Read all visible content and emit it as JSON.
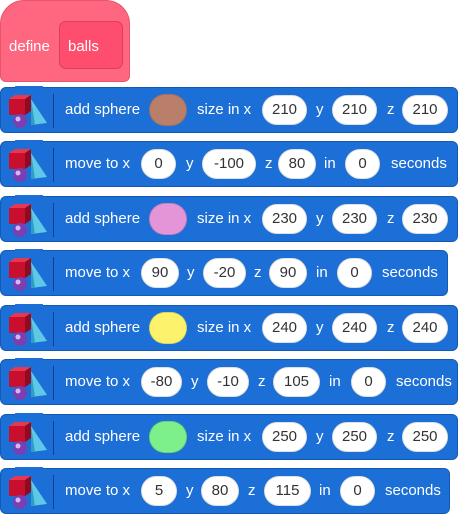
{
  "hat": {
    "label": "define",
    "param": "balls"
  },
  "blocks": [
    {
      "type": "add",
      "label": "add sphere",
      "color": "#b97f6a",
      "size_label": "size in x",
      "y_label": "y",
      "z_label": "z",
      "x": "210",
      "y": "210",
      "z": "210"
    },
    {
      "type": "move",
      "label": "move to x",
      "y_label": "y",
      "z_label": "z",
      "in_label": "in",
      "sec_label": "seconds",
      "x": "0",
      "y": "-100",
      "z": "80",
      "t": "0"
    },
    {
      "type": "add",
      "label": "add sphere",
      "color": "#e495d8",
      "size_label": "size in x",
      "y_label": "y",
      "z_label": "z",
      "x": "230",
      "y": "230",
      "z": "230"
    },
    {
      "type": "move",
      "label": "move to x",
      "y_label": "y",
      "z_label": "z",
      "in_label": "in",
      "sec_label": "seconds",
      "x": "90",
      "y": "-20",
      "z": "90",
      "t": "0"
    },
    {
      "type": "add",
      "label": "add sphere",
      "color": "#fdf26c",
      "size_label": "size in x",
      "y_label": "y",
      "z_label": "z",
      "x": "240",
      "y": "240",
      "z": "240"
    },
    {
      "type": "move",
      "label": "move to x",
      "y_label": "y",
      "z_label": "z",
      "in_label": "in",
      "sec_label": "seconds",
      "x": "-80",
      "y": "-10",
      "z": "105",
      "t": "0"
    },
    {
      "type": "add",
      "label": "add sphere",
      "color": "#7ef08a",
      "size_label": "size in x",
      "y_label": "y",
      "z_label": "z",
      "x": "250",
      "y": "250",
      "z": "250"
    },
    {
      "type": "move",
      "label": "move to x",
      "y_label": "y",
      "z_label": "z",
      "in_label": "in",
      "sec_label": "seconds",
      "x": "5",
      "y": "80",
      "z": "115",
      "t": "0"
    }
  ]
}
